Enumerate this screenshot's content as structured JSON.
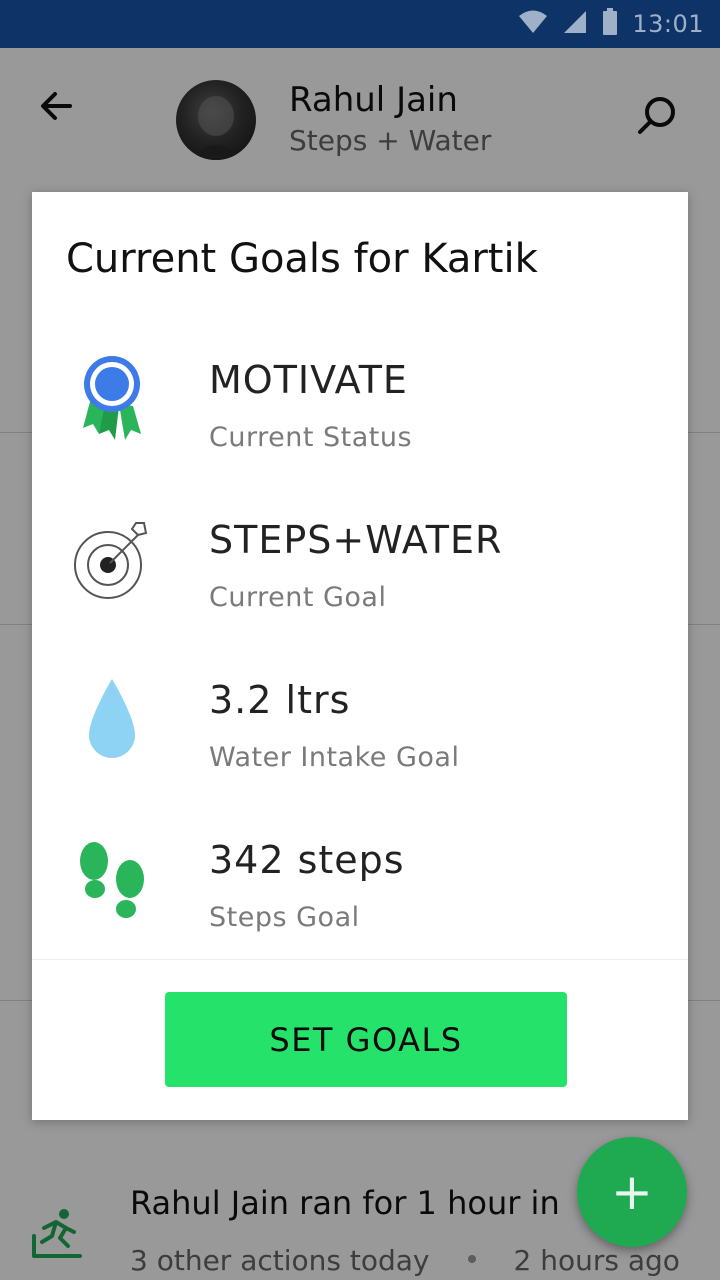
{
  "status_bar": {
    "time": "13:01",
    "icons": [
      "wifi-icon",
      "cell-signal-icon",
      "battery-icon"
    ]
  },
  "header": {
    "back_icon": "arrow-left-icon",
    "contact_name": "Rahul Jain",
    "contact_subtitle": "Steps + Water",
    "search_icon": "search-icon"
  },
  "dialog": {
    "title": "Current Goals for Kartik",
    "goals": [
      {
        "icon": "ribbon-badge-icon",
        "value": "MOTIVATE",
        "label": "Current Status"
      },
      {
        "icon": "target-icon",
        "value": "STEPS+WATER",
        "label": "Current Goal"
      },
      {
        "icon": "water-drop-icon",
        "value": "3.2 ltrs",
        "label": "Water Intake Goal"
      },
      {
        "icon": "footprints-icon",
        "value": "342 steps",
        "label": "Steps Goal"
      }
    ],
    "button_label": "SET GOALS"
  },
  "feed": {
    "item_title": "Rahul Jain ran for 1 hour in",
    "item_meta_left": "3 other actions today",
    "item_meta_right": "2 hours ago"
  },
  "fab": {
    "label": "+"
  },
  "colors": {
    "status_bar": "#0e3366",
    "accent_green": "#24e26a",
    "fab_green": "#1faa52",
    "badge_blue": "#3d7be6",
    "drop_blue": "#8fd3f4"
  }
}
